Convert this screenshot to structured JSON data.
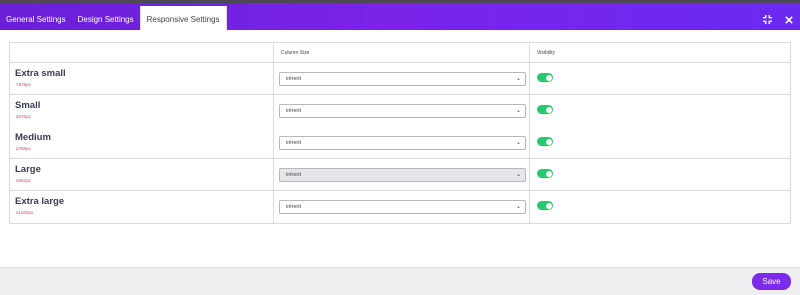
{
  "tabs": [
    {
      "label": "General Settings"
    },
    {
      "label": "Design Settings"
    },
    {
      "label": "Responsive Settings"
    }
  ],
  "active_tab": "Responsive Settings",
  "header_icons": [
    "collapse-icon",
    "close-icon"
  ],
  "table": {
    "headers": {
      "column_size": "Column Size",
      "visibility": "Visibility"
    },
    "rows": [
      {
        "name": "Extra small",
        "size": "<576px",
        "value": "inherit",
        "visible": true
      },
      {
        "name": "Small",
        "size": "≥576px",
        "value": "inherit",
        "visible": true
      },
      {
        "name": "Medium",
        "size": "≥768px",
        "value": "inherit",
        "visible": true
      },
      {
        "name": "Large",
        "size": "≥992px",
        "value": "inherit",
        "visible": true
      },
      {
        "name": "Extra large",
        "size": "≥1200px",
        "value": "inherit",
        "visible": true
      }
    ]
  },
  "footer": {
    "save_label": "Save"
  },
  "colors": {
    "accent": "#7b2bea",
    "toggle_on": "#28c76f",
    "size_text": "#e0407c"
  }
}
